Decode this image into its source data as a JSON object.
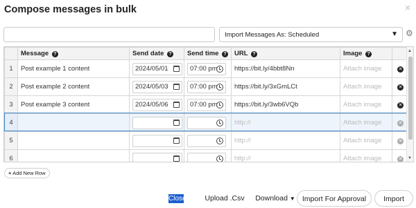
{
  "modal": {
    "title": "Compose messages in bulk",
    "close_glyph": "×"
  },
  "toolbar": {
    "search_value": "",
    "import_as": "Import Messages As: Scheduled",
    "caret_glyph": "▼",
    "gear_glyph": "⚙"
  },
  "table": {
    "columns": [
      "Message",
      "Send date",
      "Send time",
      "URL",
      "Image"
    ],
    "help_glyph": "?",
    "remove_glyph": "✕",
    "rows": [
      {
        "num": "1",
        "message": "Post example 1 content",
        "date": "2024/05/01",
        "time": "07:00 pm",
        "url": "https://bit.ly/4bbt8Nn",
        "image": "Attach image"
      },
      {
        "num": "2",
        "message": "Post example 2 content",
        "date": "2024/05/03",
        "time": "07:00 pm",
        "url": "https://bit.ly/3xGmLCt",
        "image": "Attach image"
      },
      {
        "num": "3",
        "message": "Post example 3 content",
        "date": "2024/05/06",
        "time": "07:00 pm",
        "url": "https://bit.ly/3wb6VQb",
        "image": "Attach image"
      },
      {
        "num": "4",
        "message": "",
        "date": "",
        "time": "",
        "url": "http://",
        "image": "Attach image"
      },
      {
        "num": "5",
        "message": "",
        "date": "",
        "time": "",
        "url": "http://",
        "image": "Attach image"
      },
      {
        "num": "6",
        "message": "",
        "date": "",
        "time": "",
        "url": "http://",
        "image": "Attach image"
      }
    ]
  },
  "add_row": {
    "label": "Add New Row",
    "plus_glyph": "+"
  },
  "footer": {
    "close": "Close",
    "upload": "Upload .Csv",
    "download": "Download",
    "download_caret": "▼",
    "approval": "Import For Approval",
    "import": "Import"
  },
  "colors": {
    "accent": "#3d84c8",
    "close_highlight": "#1d5fd0"
  }
}
